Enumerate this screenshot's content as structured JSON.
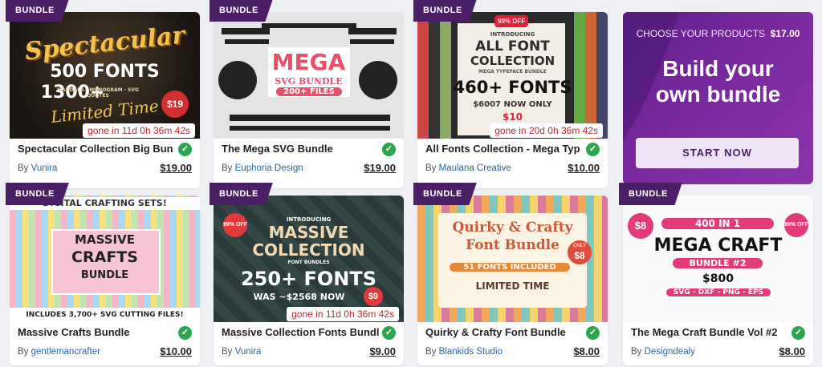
{
  "badge_label": "BUNDLE",
  "check_glyph": "✓",
  "cards": [
    {
      "title": "Spectacular Collection Big Bun",
      "by": "By",
      "author": "Vunira",
      "price": "$19.00",
      "timer": "gone in 11d 0h 36m 42s",
      "thumb": {
        "l1": "Spectacular",
        "l2": "500 FONTS",
        "l3": "1300+",
        "l4": "Limited Time",
        "tag": "$19",
        "sub": "MANDALA · MONOGRAM · SVG QUOTES"
      }
    },
    {
      "title": "The Mega SVG Bundle",
      "by": "By",
      "author": "Euphoria Design",
      "price": "$19.00",
      "thumb": {
        "l1": "MEGA",
        "l2": "SVG BUNDLE",
        "l3": "200+ FILES"
      }
    },
    {
      "title": "All Fonts Collection - Mega Typ",
      "by": "By",
      "author": "Maulana Creative",
      "price": "$10.00",
      "timer": "gone in 20d 0h 36m 42s",
      "thumb": {
        "off": "99% OFF",
        "l0": "INTRODUCING",
        "l1": "ALL FONT",
        "l2": "COLLECTION",
        "l2b": "MEGA TYPEFACE BUNDLE",
        "l3": "460+ FONTS",
        "l4": "$6007 NOW ONLY",
        "l5": "$10"
      }
    },
    {
      "title": "Massive Crafts Bundle",
      "by": "By",
      "author": "gentlemancrafter",
      "price": "$10.00",
      "thumb": {
        "top": "DIGITAL CRAFTING SETS!",
        "l1": "MASSIVE",
        "l2": "CRAFTS",
        "l3": "BUNDLE",
        "bottom": "INCLUDES 3,700+ SVG CUTTING FILES!"
      }
    },
    {
      "title": "Massive Collection Fonts Bundl",
      "by": "By",
      "author": "Vunira",
      "price": "$9.00",
      "timer": "gone in 11d 0h 36m 42s",
      "thumb": {
        "off": "99% OFF",
        "l0": "INTRODUCING",
        "l1": "MASSIVE",
        "l2": "COLLECTION",
        "l2b": "FONT BUNDLES",
        "l3": "250+ FONTS",
        "l4": "WAS ~$2568 NOW",
        "l5": "$9"
      }
    },
    {
      "title": "Quirky & Crafty Font Bundle",
      "by": "By",
      "author": "Blankids Studio",
      "price": "$8.00",
      "thumb": {
        "l1": "Quirky & Crafty",
        "l2": "Font Bundle",
        "l3": "51 FONTS INCLUDED",
        "l4": "LIMITED TIME",
        "off": "ONLY",
        "l5": "$8"
      }
    },
    {
      "title": "The Mega Craft Bundle Vol #2",
      "by": "By",
      "author": "Designdealy",
      "price": "$8.00",
      "thumb": {
        "tag": "$8",
        "l0": "400 IN 1",
        "l1": "MEGA CRAFT",
        "l2": "BUNDLE #2",
        "l3": "$800",
        "l4": "SVG - DXF - PNG - EPS",
        "off": "99% OFF"
      }
    }
  ],
  "build": {
    "choose_label": "CHOOSE YOUR PRODUCTS",
    "choose_price": "$17.00",
    "heading_line1": "Build your",
    "heading_line2": "own bundle",
    "button": "START NOW"
  },
  "colors": {
    "accent": "#4a1f66",
    "success": "#2ea44f",
    "link": "#2c65a8",
    "timer": "#c0262d"
  }
}
